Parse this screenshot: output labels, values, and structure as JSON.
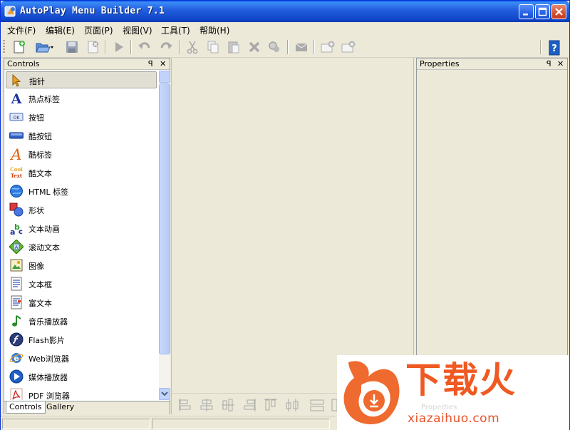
{
  "window": {
    "title": "AutoPlay Menu Builder 7.1"
  },
  "menubar": {
    "items": [
      {
        "label": "文件(F)"
      },
      {
        "label": "编辑(E)"
      },
      {
        "label": "页面(P)"
      },
      {
        "label": "视图(V)"
      },
      {
        "label": "工具(T)"
      },
      {
        "label": "帮助(H)"
      }
    ]
  },
  "toolbar": {
    "icons": [
      "new-file-icon",
      "open-icon",
      "save-icon",
      "close-doc-icon",
      "run-icon",
      "undo-icon",
      "redo-icon",
      "cut-icon",
      "copy-icon",
      "paste-icon",
      "delete-icon",
      "find-icon",
      "email-icon",
      "add-page-icon",
      "remove-page-icon",
      "help-icon"
    ]
  },
  "controls_panel": {
    "title": "Controls",
    "pin_glyph": "ꟼ",
    "close_glyph": "✕",
    "items": [
      {
        "label": "指针",
        "icon": "pointer-icon"
      },
      {
        "label": "热点标签",
        "icon": "hotspot-label-icon"
      },
      {
        "label": "按钮",
        "icon": "button-icon"
      },
      {
        "label": "酷按钮",
        "icon": "cool-button-icon"
      },
      {
        "label": "酷标签",
        "icon": "cool-label-icon"
      },
      {
        "label": "酷文本",
        "icon": "cool-text-icon"
      },
      {
        "label": "HTML 标签",
        "icon": "html-label-icon"
      },
      {
        "label": "形状",
        "icon": "shape-icon"
      },
      {
        "label": "文本动画",
        "icon": "text-animation-icon"
      },
      {
        "label": "滚动文本",
        "icon": "scrolling-text-icon"
      },
      {
        "label": "图像",
        "icon": "image-icon"
      },
      {
        "label": "文本框",
        "icon": "textbox-icon"
      },
      {
        "label": "富文本",
        "icon": "rich-text-icon"
      },
      {
        "label": "音乐播放器",
        "icon": "music-player-icon"
      },
      {
        "label": "Flash影片",
        "icon": "flash-movie-icon"
      },
      {
        "label": "Web浏览器",
        "icon": "web-browser-icon"
      },
      {
        "label": "媒体播放器",
        "icon": "media-player-icon"
      },
      {
        "label": "PDF 浏览器",
        "icon": "pdf-browser-icon"
      }
    ],
    "selected_index": 0,
    "tabs": [
      {
        "label": "Controls"
      },
      {
        "label": "Gallery"
      }
    ],
    "active_tab": 0
  },
  "properties_panel": {
    "title": "Properties",
    "pin_glyph": "ꟼ",
    "close_glyph": "✕"
  },
  "cool_text_icon_text": "Cool Text",
  "ok_button_icon_text": "OK",
  "watermark": {
    "site": "xiazaihuo.com",
    "brand": "下载火",
    "ghost_text": "Properties"
  }
}
